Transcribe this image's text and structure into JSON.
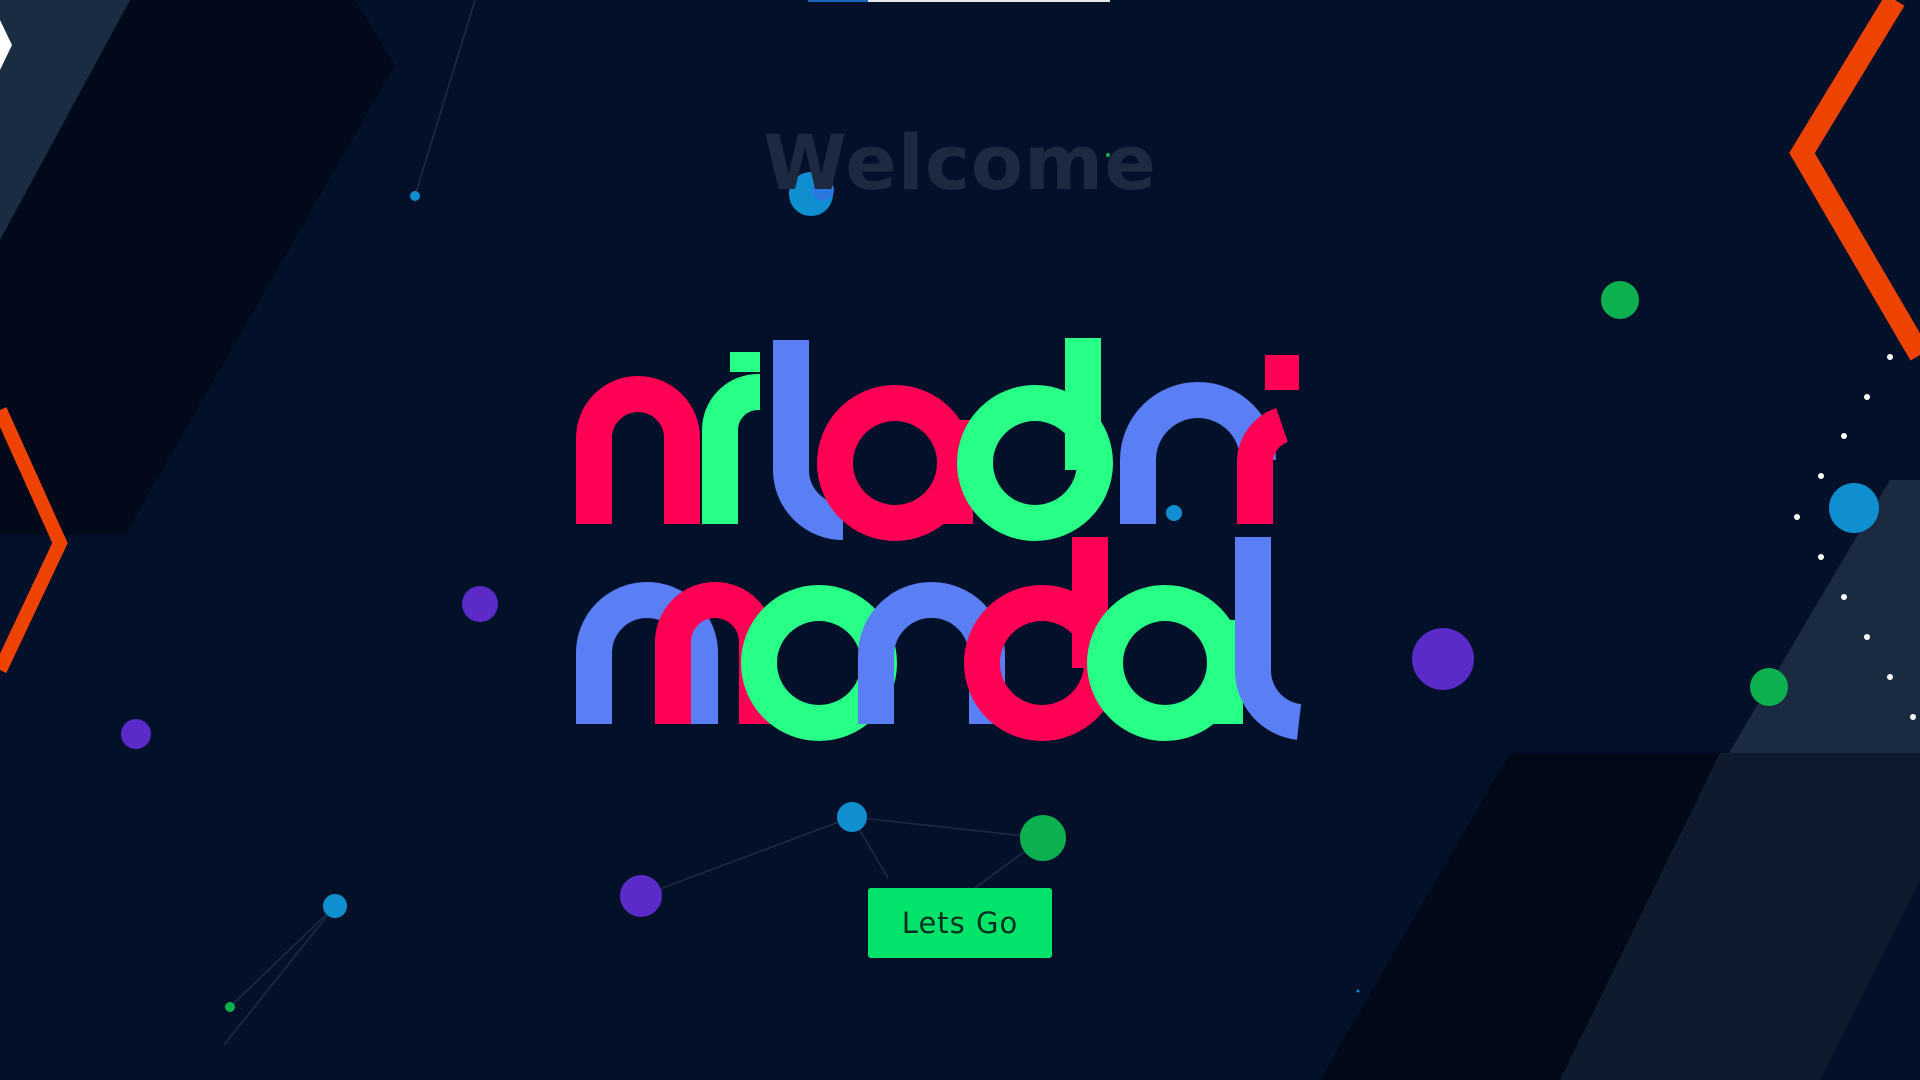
{
  "hero": {
    "greeting": "Welcome",
    "name_line_1": "niladri",
    "name_line_2": "mondal",
    "cta_label": "Lets Go"
  },
  "loader": {
    "progress": 0.2
  },
  "colors": {
    "background": "#021129",
    "red": "#ff0055",
    "green": "#27ff87",
    "blue": "#5a7ff5",
    "accent_orange": "#ee4300",
    "button": "#00e46a",
    "particle_purple": "#5a2bc8",
    "particle_cyan": "#0f8fd0",
    "particle_green": "#0cb04e"
  }
}
